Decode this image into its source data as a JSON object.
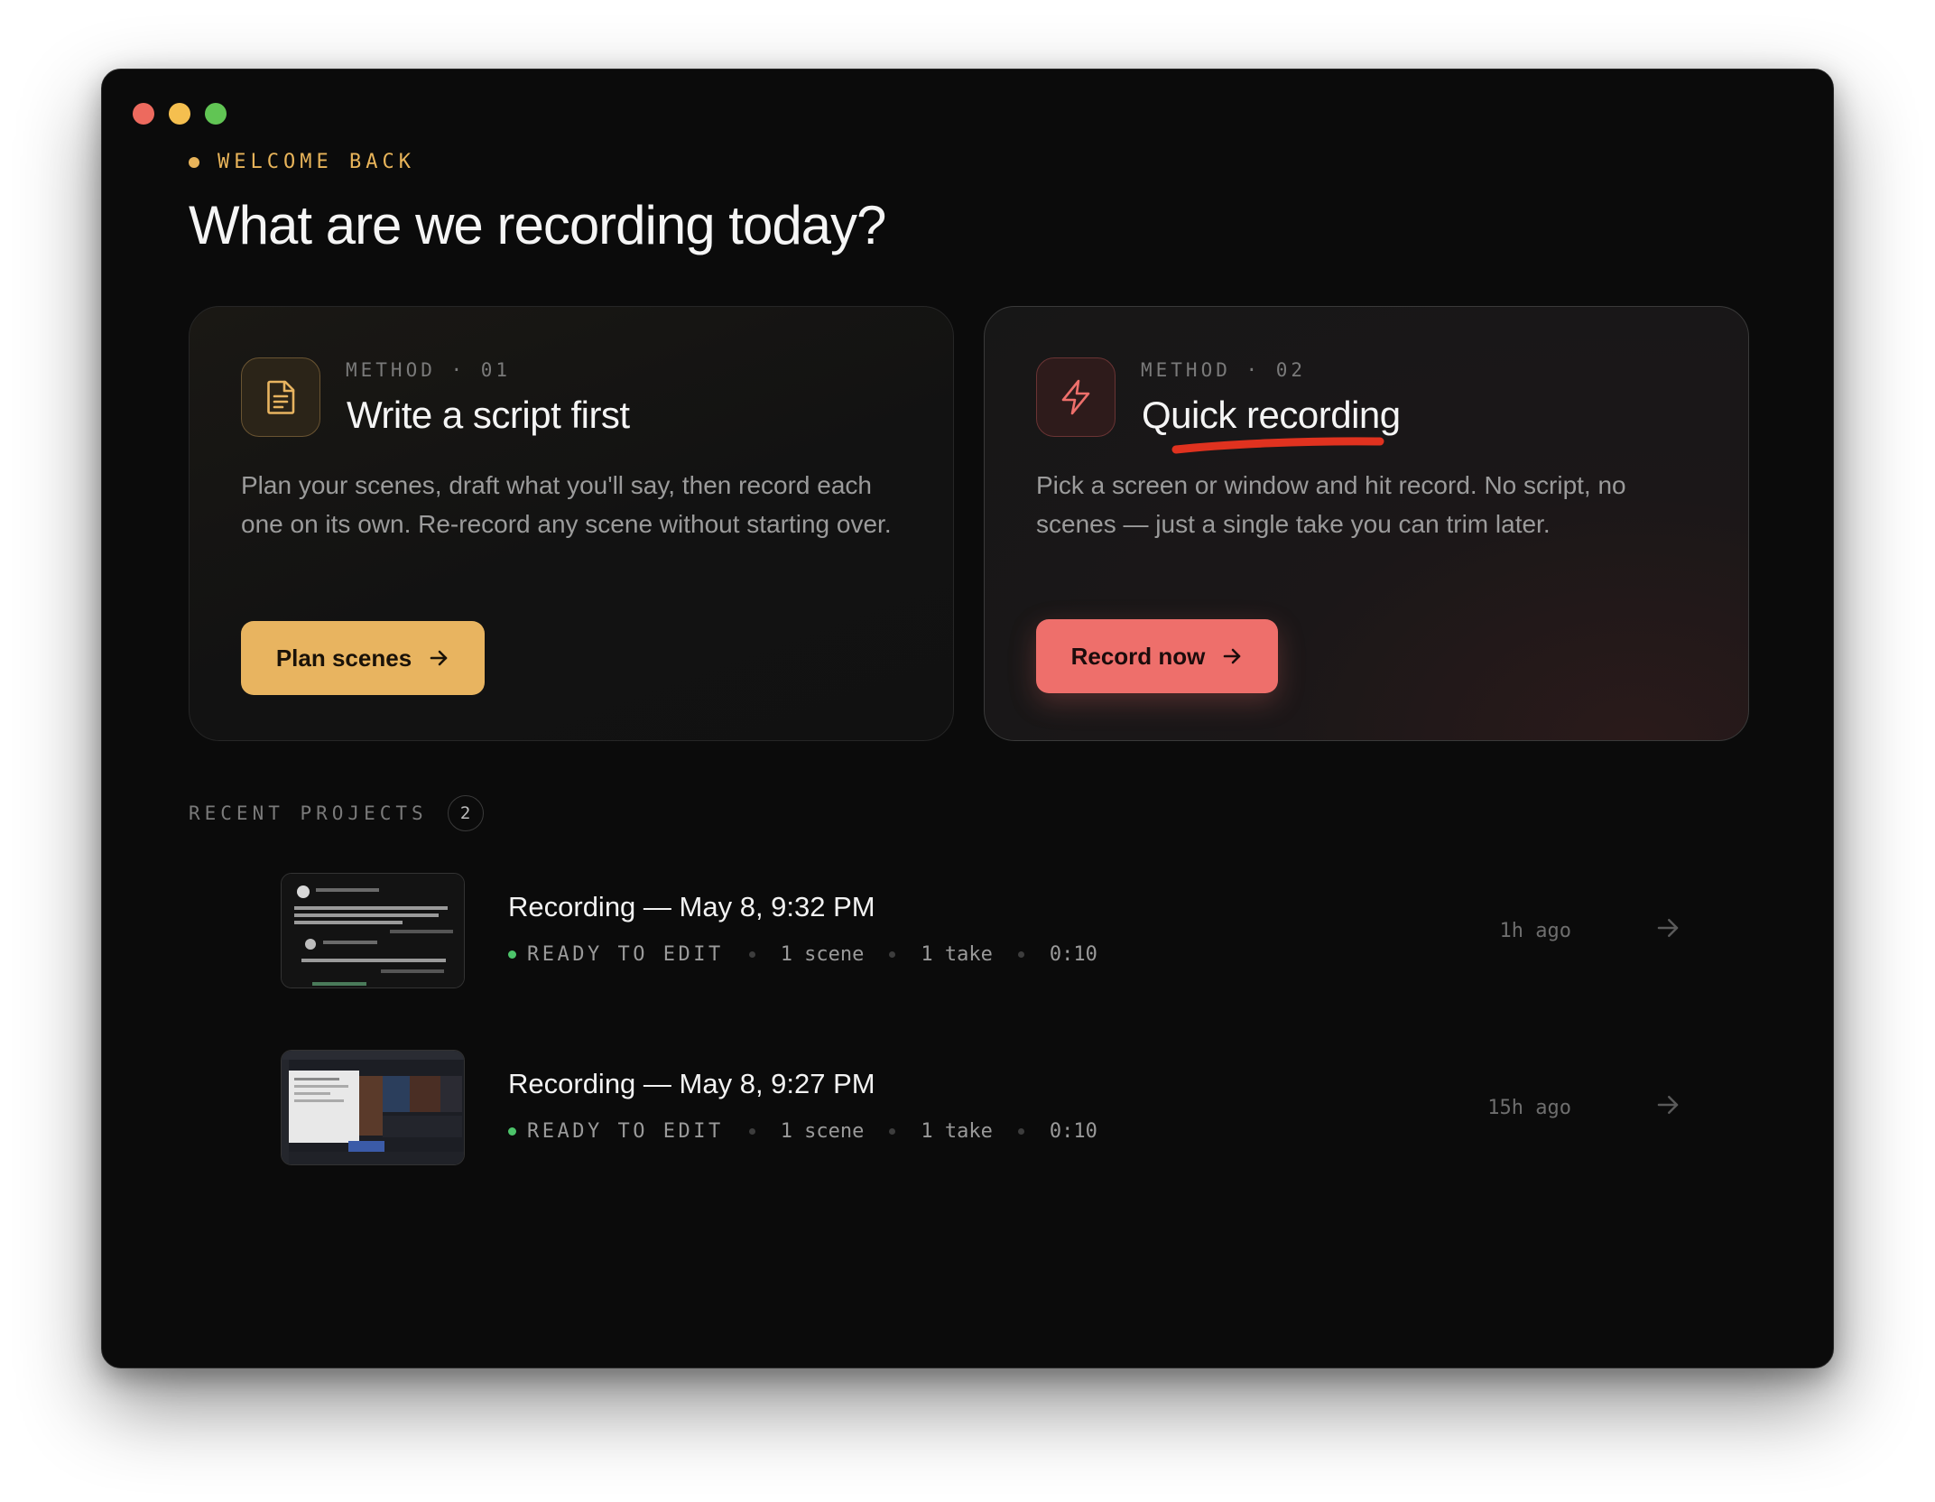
{
  "header": {
    "eyebrow": "WELCOME BACK",
    "title": "What are we recording today?"
  },
  "methods": [
    {
      "label": "METHOD · 01",
      "title": "Write a script first",
      "description": "Plan your scenes, draft what you'll say, then record each one on its own. Re-record any scene without starting over.",
      "cta": "Plan scenes",
      "icon": "document-icon",
      "accent": "#e8b460"
    },
    {
      "label": "METHOD · 02",
      "title": "Quick recording",
      "description": "Pick a screen or window and hit record. No script, no scenes — just a single take you can trim later.",
      "cta": "Record now",
      "icon": "lightning-icon",
      "accent": "#ee6f6b"
    }
  ],
  "recent": {
    "label": "RECENT PROJECTS",
    "count": "2",
    "projects": [
      {
        "title": "Recording — May 8, 9:32 PM",
        "status": "READY TO EDIT",
        "scenes": "1 scene",
        "takes": "1 take",
        "duration": "0:10",
        "age": "1h ago"
      },
      {
        "title": "Recording — May 8, 9:27 PM",
        "status": "READY TO EDIT",
        "scenes": "1 scene",
        "takes": "1 take",
        "duration": "0:10",
        "age": "15h ago"
      }
    ]
  },
  "colors": {
    "status_ready": "#4cc46a",
    "underline": "#e0321f"
  }
}
